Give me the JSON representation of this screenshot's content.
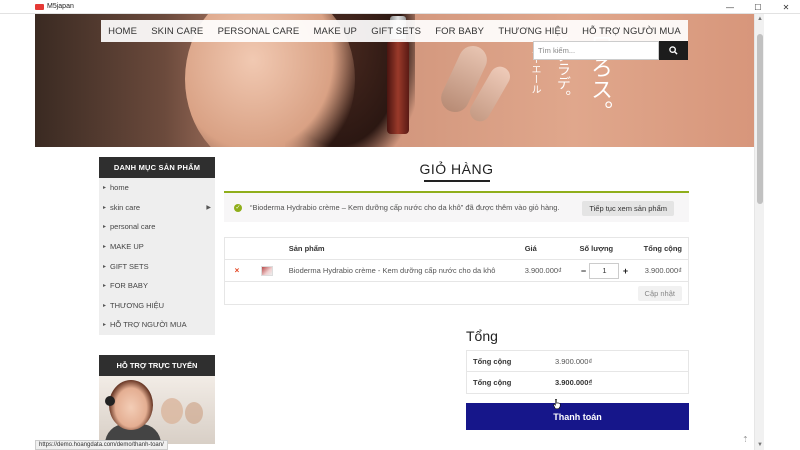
{
  "window": {
    "title": "M5japan",
    "controls": [
      "—",
      "☐",
      "✕"
    ]
  },
  "nav": {
    "items": [
      "HOME",
      "SKIN CARE",
      "PERSONAL CARE",
      "MAKE UP",
      "GIFT SETS",
      "FOR BABY",
      "THƯƠNG HIỆU",
      "HỖ TRỢ NGƯỜI MUA"
    ]
  },
  "search": {
    "placeholder": "Tìm kiếm...",
    "icon": "search-icon"
  },
  "banner": {
    "jp_text_1": "口ろス。",
    "jp_text_2": "とグラデ。",
    "jp_text_3": "ルーエール"
  },
  "sidebar": {
    "heading": "DANH MỤC SẢN PHẨM",
    "items": [
      {
        "label": "home",
        "has_children": false
      },
      {
        "label": "skin care",
        "has_children": true
      },
      {
        "label": "personal care",
        "has_children": false
      },
      {
        "label": "MAKE UP",
        "has_children": false
      },
      {
        "label": "GIFT SETS",
        "has_children": false
      },
      {
        "label": "FOR BABY",
        "has_children": false
      },
      {
        "label": "THƯƠNG HIỆU",
        "has_children": false
      },
      {
        "label": "HỖ TRỢ NGƯỜI MUA",
        "has_children": false
      }
    ],
    "support_heading": "HỖ TRỢ TRỰC TUYẾN"
  },
  "main": {
    "page_title": "GIỎ HÀNG",
    "notice": {
      "text": "“Bioderma Hydrabio crème – Kem dưỡng cấp nước cho da khô” đã được thêm vào giỏ hàng.",
      "button": "Tiếp tục xem sản phẩm",
      "color": "#8fae1b"
    },
    "cart": {
      "headers": {
        "product": "Sản phẩm",
        "price": "Giá",
        "quantity": "Số lượng",
        "total": "Tổng cộng"
      },
      "items": [
        {
          "remove": "×",
          "name": "Bioderma Hydrabio crème - Kem dưỡng cấp nước cho da khô",
          "price": "3.900.000₫",
          "quantity": "1",
          "total": "3.900.000₫"
        }
      ],
      "qty_minus": "−",
      "qty_plus": "+",
      "update_button": "Cập nhật"
    },
    "totals": {
      "title": "Tổng",
      "rows": [
        {
          "label": "Tổng cộng",
          "value": "3.900.000₫"
        },
        {
          "label": "Tổng cộng",
          "value": "3.900.000₫"
        }
      ],
      "checkout_button": "Thanh toán",
      "checkout_color": "#16168a"
    }
  },
  "statusbar": {
    "url": "https://demo.hoangdata.com/demo/thanh-toan/"
  },
  "back_to_top": "⇡"
}
